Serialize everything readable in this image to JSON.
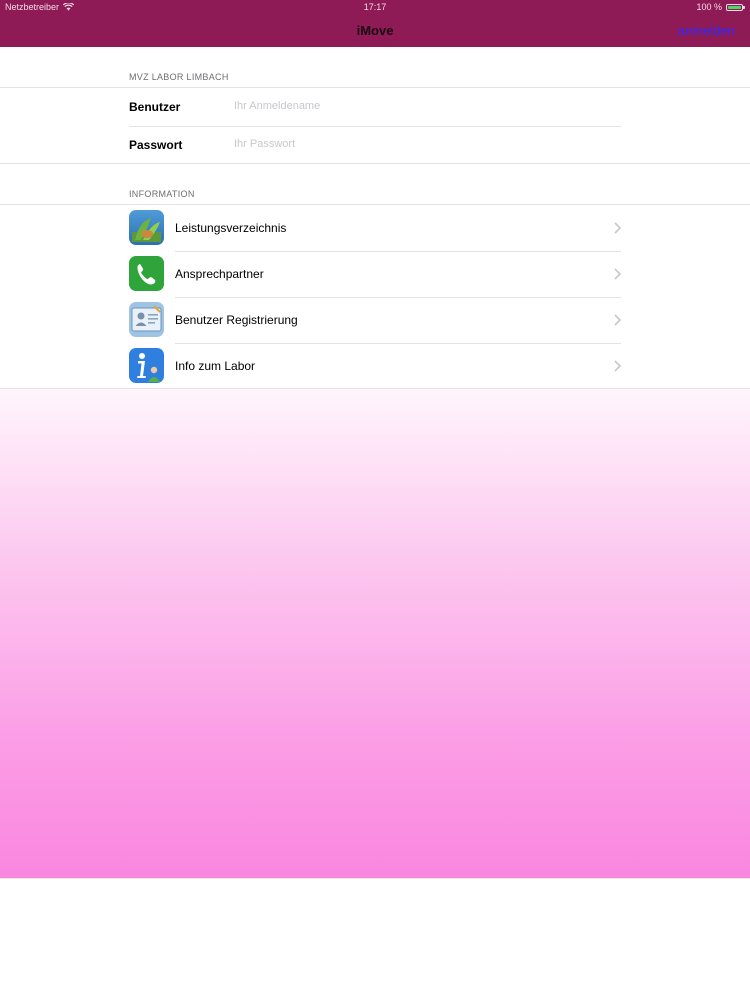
{
  "status_bar": {
    "carrier": "Netzbetreiber",
    "time": "17:17",
    "battery": "100 %"
  },
  "nav": {
    "title": "iMove",
    "login_label": "anmelden"
  },
  "login_section": {
    "header": "MVZ LABOR LIMBACH",
    "user_label": "Benutzer",
    "user_placeholder": "Ihr Anmeldename",
    "password_label": "Passwort",
    "password_placeholder": "Ihr Passwort"
  },
  "info_section": {
    "header": "INFORMATION",
    "items": [
      {
        "label": "Leistungsverzeichnis",
        "icon": "leaf-book-icon"
      },
      {
        "label": "Ansprechpartner",
        "icon": "phone-icon"
      },
      {
        "label": "Benutzer Registrierung",
        "icon": "id-card-icon"
      },
      {
        "label": "Info zum Labor",
        "icon": "info-person-icon"
      }
    ]
  },
  "colors": {
    "nav_bar": "#8e1b55",
    "link": "#2d2aff",
    "battery": "#4cd964",
    "gradient_bottom": "#fa86df"
  }
}
